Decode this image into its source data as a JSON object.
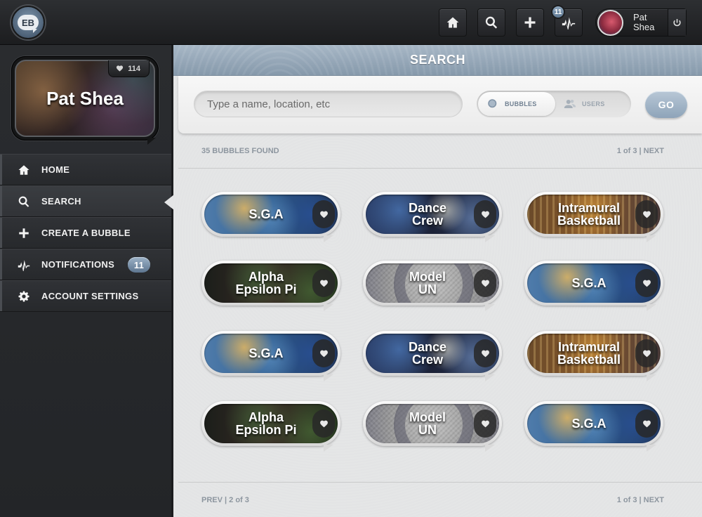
{
  "topbar": {
    "logo_text": "EB",
    "buttons": [
      {
        "name": "home",
        "icon": "home-icon"
      },
      {
        "name": "search",
        "icon": "search-icon"
      },
      {
        "name": "add",
        "icon": "plus-icon"
      },
      {
        "name": "activity",
        "icon": "pulse-icon",
        "badge": "11"
      }
    ],
    "user": {
      "first": "Pat",
      "last": "Shea"
    },
    "power_icon": "power-icon"
  },
  "profile": {
    "name": "Pat Shea",
    "likes": "114"
  },
  "nav": {
    "items": [
      {
        "label": "HOME",
        "icon": "home-icon",
        "active": false
      },
      {
        "label": "SEARCH",
        "icon": "search-icon",
        "active": true
      },
      {
        "label": "CREATE A BUBBLE",
        "icon": "plus-icon",
        "active": false
      },
      {
        "label": "NOTIFICATIONS",
        "icon": "pulse-icon",
        "active": false,
        "badge": "11"
      },
      {
        "label": "ACCOUNT SETTINGS",
        "icon": "gear-icon",
        "active": false
      }
    ]
  },
  "main": {
    "title": "SEARCH",
    "search": {
      "placeholder": "Type a name, location, etc",
      "value": "",
      "toggle": {
        "options": [
          "BUBBLES",
          "USERS"
        ],
        "selected": "BUBBLES"
      },
      "go_label": "GO"
    },
    "results": {
      "found": "35 BUBBLES FOUND",
      "pager_top": "1 of 3 | NEXT",
      "pager_bottom_left": "PREV | 2 of 3",
      "pager_bottom_right": "1 of 3 | NEXT"
    },
    "bubbles": [
      {
        "title": "S.G.A",
        "theme": "sga"
      },
      {
        "title": "Dance\nCrew",
        "theme": "dance"
      },
      {
        "title": "Intramural\nBasketball",
        "theme": "intra"
      },
      {
        "title": "Alpha\nEpsilon Pi",
        "theme": "alpha"
      },
      {
        "title": "Model\nUN",
        "theme": "un"
      },
      {
        "title": "S.G.A",
        "theme": "sga"
      },
      {
        "title": "S.G.A",
        "theme": "sga"
      },
      {
        "title": "Dance\nCrew",
        "theme": "dance"
      },
      {
        "title": "Intramural\nBasketball",
        "theme": "intra"
      },
      {
        "title": "Alpha\nEpsilon Pi",
        "theme": "alpha"
      },
      {
        "title": "Model\nUN",
        "theme": "un"
      },
      {
        "title": "S.G.A",
        "theme": "sga"
      }
    ]
  },
  "colors": {
    "accent": "#8fa5ba",
    "header": "#97a8b9",
    "sidebar": "#2a2c2f",
    "content_bg": "#e3e4e5"
  }
}
